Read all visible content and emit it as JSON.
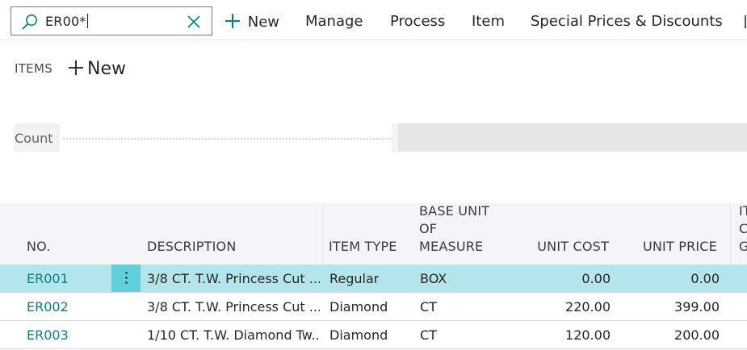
{
  "search": {
    "value": "ER00*"
  },
  "actions": [
    {
      "label": "New"
    },
    {
      "label": "Manage"
    },
    {
      "label": "Process"
    },
    {
      "label": "Item"
    },
    {
      "label": "Special Prices & Discounts"
    }
  ],
  "items_part": {
    "title": "ITEMS",
    "new_label": "New"
  },
  "factbox": {
    "count_label": "Count"
  },
  "table": {
    "columns": {
      "no": "NO.",
      "description": "DESCRIPTION",
      "item_type": "ITEM TYPE",
      "base_unit_l1": "BASE UNIT",
      "base_unit_l2": "OF",
      "base_unit_l3": "MEASURE",
      "unit_cost": "UNIT COST",
      "unit_price": "UNIT PRICE",
      "cut_l1": "IT",
      "cut_l2": "C",
      "cut_l3": "G"
    },
    "rows": [
      {
        "no": "ER001",
        "description": "3/8 CT. T.W. Princess Cut ...",
        "item_type": "Regular",
        "base_unit": "BOX",
        "unit_cost": "0.00",
        "unit_price": "0.00",
        "selected": true
      },
      {
        "no": "ER002",
        "description": "3/8 CT. T.W. Princess Cut ...",
        "item_type": "Diamond",
        "base_unit": "CT",
        "unit_cost": "220.00",
        "unit_price": "399.00",
        "selected": false
      },
      {
        "no": "ER003",
        "description": "1/10 CT. T.W. Diamond Tw...",
        "item_type": "Diamond",
        "base_unit": "CT",
        "unit_cost": "120.00",
        "unit_price": "200.00",
        "selected": false
      }
    ]
  },
  "colors": {
    "accent": "#008489",
    "link": "#0a7e86",
    "selected_row": "#b3e6ea",
    "selected_menu_button": "#62d0d8"
  }
}
